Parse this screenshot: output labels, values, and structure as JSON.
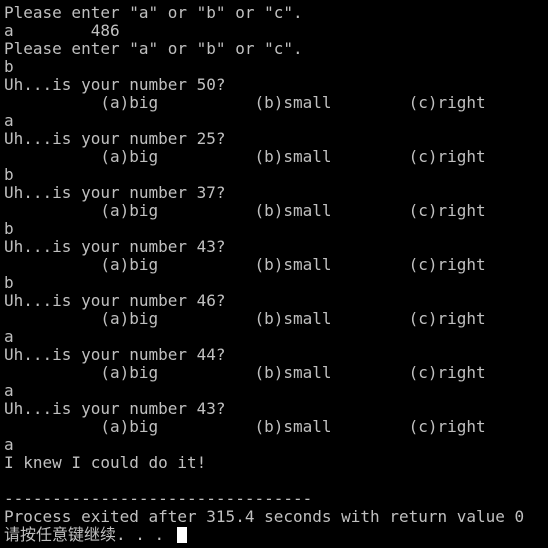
{
  "console": {
    "lines": [
      "Please enter \"a\" or \"b\" or \"c\".",
      "a        486",
      "Please enter \"a\" or \"b\" or \"c\".",
      "b",
      "Uh...is your number 50?",
      "          (a)big          (b)small        (c)right",
      "a",
      "Uh...is your number 25?",
      "          (a)big          (b)small        (c)right",
      "b",
      "Uh...is your number 37?",
      "          (a)big          (b)small        (c)right",
      "b",
      "Uh...is your number 43?",
      "          (a)big          (b)small        (c)right",
      "b",
      "Uh...is your number 46?",
      "          (a)big          (b)small        (c)right",
      "a",
      "Uh...is your number 44?",
      "          (a)big          (b)small        (c)right",
      "a",
      "Uh...is your number 43?",
      "          (a)big          (b)small        (c)right",
      "a",
      "I knew I could do it!",
      "",
      "--------------------------------",
      "Process exited after 315.4 seconds with return value 0",
      "请按任意键继续. . . "
    ]
  }
}
